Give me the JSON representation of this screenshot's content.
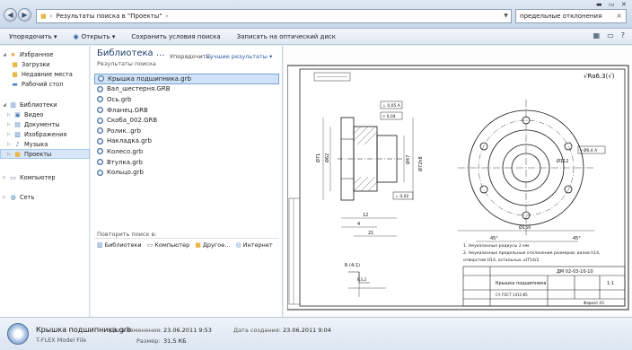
{
  "address_bar": {
    "path": "Результаты поиска в \"Проекты\""
  },
  "search_box": {
    "value": "предельные отклонения"
  },
  "toolbar": {
    "organize": "Упорядочить",
    "open": "Открыть",
    "save_search": "Сохранить условия поиска",
    "burn": "Записать на оптический диск"
  },
  "nav": {
    "favorites": {
      "label": "Избранное",
      "items": [
        "Загрузки",
        "Недавние места",
        "Рабочий стол"
      ]
    },
    "libraries": {
      "label": "Библиотеки",
      "items": [
        "Видео",
        "Документы",
        "Изображения",
        "Музыка",
        "Проекты"
      ]
    },
    "computer": "Компьютер",
    "network": "Сеть"
  },
  "results": {
    "title": "Библиотека ...",
    "subtitle": "Результаты поиска",
    "arrange_label": "Упорядочить:",
    "arrange_value": "Лучшие результаты",
    "files": [
      "Крышка подшипника.grb",
      "Вал_шестерня.GRB",
      "Ось.grb",
      "Фланец.GRB",
      "Скоба_002.GRB",
      "Ролик..grb",
      "Накладка.grb",
      "Колесо.grb",
      "Втулка.grb",
      "Кольцо.grb"
    ],
    "repeat_label": "Повторить поиск в:",
    "repeat_targets": [
      "Библиотеки",
      "Компьютер",
      "Другое...",
      "Интернет"
    ]
  },
  "preview": {
    "title_block": {
      "code": "ДМ 02-03-10-10",
      "name": "Крышка подшипника",
      "material": "СЧ ГОСТ 1412-85",
      "sheet_label": "Формат А3",
      "scale": "1:1"
    },
    "roughness": "Ra6.3",
    "notes": [
      "1. Неуказанные радиусы 2 мм.",
      "2. Неуказанные предельные отклонения размеров: валов h14,",
      "отверстий H14, остальных ±IT14/2"
    ],
    "section_label": "Б (4:1)",
    "view_label": "В"
  },
  "details": {
    "filename": "Крышка подшипника.grb",
    "filetype": "T-FLEX Model File",
    "modified_label": "Дата изменения:",
    "modified_value": "23.06.2011 9:53",
    "created_label": "Дата создания:",
    "created_value": "23.06.2011 9:04",
    "size_label": "Размер:",
    "size_value": "31,5 КБ"
  }
}
